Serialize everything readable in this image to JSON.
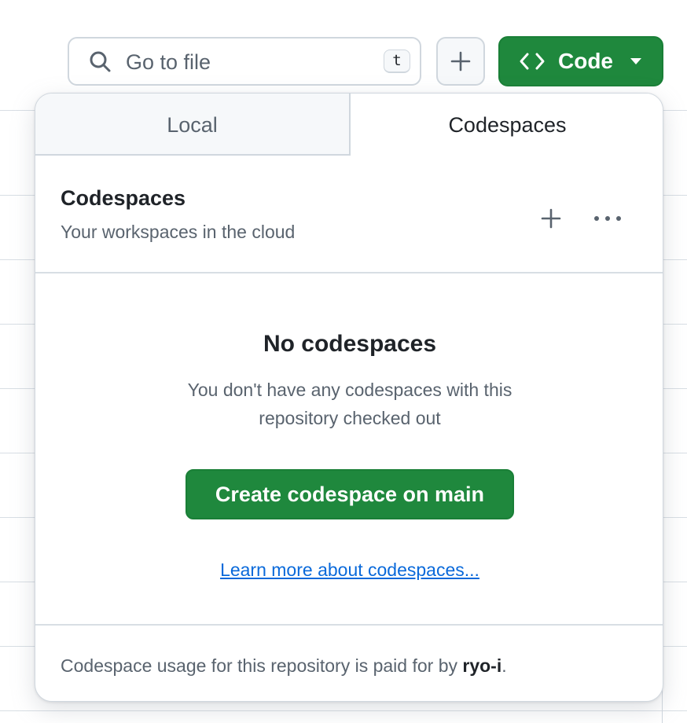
{
  "toolbar": {
    "search_placeholder": "Go to file",
    "search_shortcut": "t",
    "add_icon": "plus-icon",
    "code_button_label": "Code"
  },
  "dropdown": {
    "tabs": [
      {
        "label": "Local",
        "selected": false
      },
      {
        "label": "Codespaces",
        "selected": true
      }
    ],
    "header": {
      "title": "Codespaces",
      "subtitle": "Your workspaces in the cloud"
    },
    "empty_state": {
      "title": "No codespaces",
      "description": "You don't have any codespaces with this repository checked out",
      "create_button": "Create codespace on main",
      "learn_link": "Learn more about codespaces..."
    },
    "footer": {
      "text_prefix": "Codespace usage for this repository is paid for by ",
      "owner": "ryo-i",
      "text_suffix": "."
    }
  },
  "colors": {
    "primary_green": "#1f883d",
    "link_blue": "#0969da",
    "muted_text": "#59636e",
    "border": "#d0d7de"
  }
}
